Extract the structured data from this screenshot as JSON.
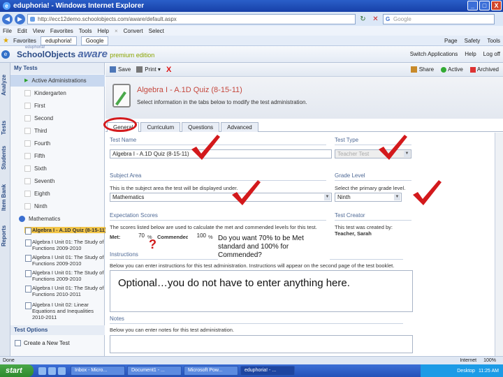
{
  "window": {
    "title": "eduphoria! - Windows Internet Explorer",
    "buttons": [
      "_",
      "□",
      "X"
    ]
  },
  "address": {
    "url": "http://ecc12demo.schoolobjects.com/aware/default.aspx",
    "search_placeholder": "Google"
  },
  "menu": {
    "items": [
      "File",
      "Edit",
      "View",
      "Favorites",
      "Tools",
      "Help"
    ],
    "extras": [
      "Convert",
      "Select"
    ]
  },
  "favorites": {
    "label": "Favorites",
    "tabs": [
      "eduphoria!",
      "Google"
    ],
    "right": [
      "Page",
      "Safety",
      "Tools"
    ]
  },
  "app": {
    "brand_top": "eduphoria!",
    "brand": "SchoolObjects",
    "product": "aware",
    "edition": "premium edition",
    "links": [
      "Switch Applications",
      "Help",
      "Log off"
    ]
  },
  "vtabs": [
    "Analyze",
    "Tests",
    "Students",
    "Item Bank",
    "Reports"
  ],
  "tree": {
    "header": "My Tests",
    "items": [
      "Active Administrations",
      "Kindergarten",
      "First",
      "Second",
      "Third",
      "Fourth",
      "Fifth",
      "Sixth",
      "Seventh",
      "Eighth",
      "Ninth"
    ],
    "subject": "Mathematics",
    "docs": [
      "Algebra I - A.1D Quiz (8-15-11)",
      "Algebra I Unit 01: The Study of Functions 2009-2010",
      "Algebra I Unit 01: The Study of Functions 2009-2010",
      "Algebra I Unit 01: The Study of Functions 2009-2010",
      "Algebra I Unit 01: The Study of Functions 2010-2011",
      "Algebra I Unit 02: Linear Equations and Inequalities 2010-2011"
    ],
    "options_header": "Test Options",
    "new_test": "Create a New Test"
  },
  "toolbar": {
    "save": "Save",
    "print": "Print",
    "delete": "X",
    "share": "Share",
    "active": "Active",
    "archived": "Archived"
  },
  "test": {
    "title": "Algebra I - A.1D Quiz (8-15-11)",
    "description": "Select information in the tabs below to modify the test administration."
  },
  "tabs": [
    "General",
    "Curriculum",
    "Questions",
    "Advanced"
  ],
  "form": {
    "test_name_label": "Test Name",
    "test_name_value": "Algebra I - A.1D Quiz (8-15-11)",
    "test_type_label": "Test Type",
    "test_type_value": "Teacher Test",
    "subject_label": "Subject Area",
    "subject_help": "This is the subject area the test will be displayed under.",
    "subject_value": "Mathematics",
    "grade_label": "Grade Level",
    "grade_help": "Select the primary grade level.",
    "grade_value": "Ninth",
    "scores_label": "Expectation Scores",
    "scores_help": "The scores listed below are used to calculate the met and commended levels for this test.",
    "met_label": "Met:",
    "met_value": "70",
    "commended_label": "Commended:",
    "commended_value": "100",
    "percent": "%",
    "creator_label": "Test Creator",
    "creator_help": "This test was created by:",
    "creator_value": "Teacher, Sarah",
    "instructions_label": "Instructions",
    "instructions_help": "Below you can enter instructions for this test administration. Instructions will appear on the second page of the test booklet.",
    "notes_label": "Notes",
    "notes_help": "Below you can enter notes for this test administration."
  },
  "annotations": {
    "question_mark": "?",
    "callout": "Do you want 70% to be Met standard and 100% for Commended?",
    "optional_note": "Optional…you do not have to enter anything here."
  },
  "status": {
    "left": "Done",
    "zone": "Internet",
    "zoom": "100%"
  },
  "taskbar": {
    "start": "start",
    "tasks": [
      "Inbox - Micro...",
      "Document1 - ...",
      "Microsoft Pow...",
      "eduphoria! - ..."
    ],
    "tray_label": "Desktop",
    "time": "11:25 AM"
  },
  "colors": {
    "accent_red": "#d3191c",
    "title_blue": "#1740a8",
    "title_red": "#c5483e",
    "label_blue": "#4f6a96"
  }
}
